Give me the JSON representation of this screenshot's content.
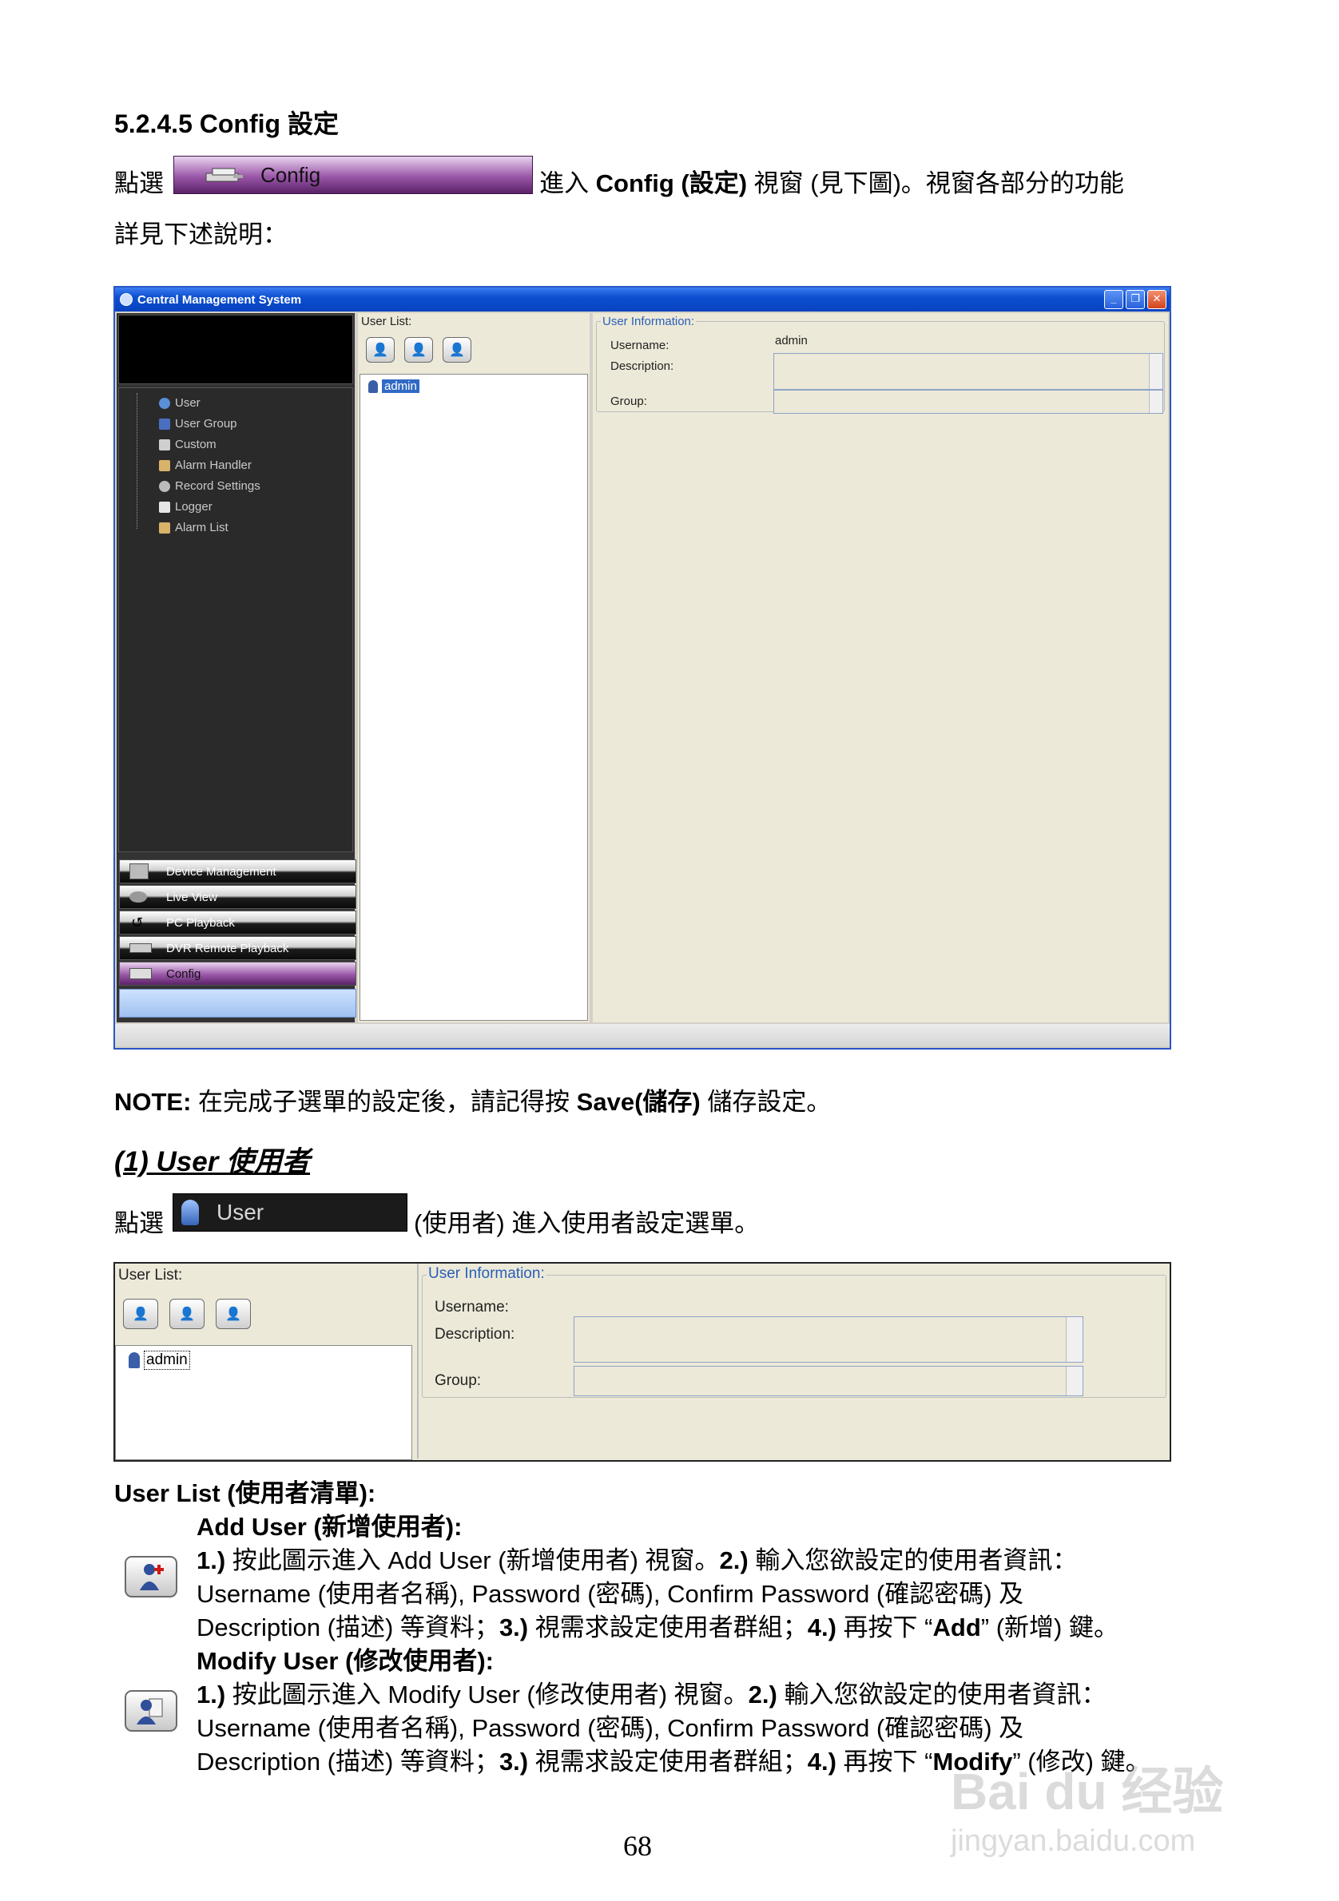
{
  "section_heading": "5.2.4.5 Config 設定",
  "intro": {
    "click_prefix": "點選",
    "button_label": "Config",
    "text_a": "進入 ",
    "text_b": "Config (設定)",
    "text_c": " 視窗 (見下圖)。視窗各部分的功能",
    "line2": "詳見下述說明："
  },
  "screenshot": {
    "title": "Central Management System",
    "tree_items": [
      "User",
      "User Group",
      "Custom",
      "Alarm Handler",
      "Record Settings",
      "Logger",
      "Alarm List"
    ],
    "nav_buttons": [
      "Device Management",
      "Live View",
      "PC Playback",
      "DVR Remote Playback",
      "Config"
    ],
    "user_list_label": "User List:",
    "list_item": "admin",
    "info_label": "User Information:",
    "username_label": "Username:",
    "username_value": "admin",
    "description_label": "Description:",
    "group_label": "Group:"
  },
  "note": {
    "label": "NOTE:",
    "text_a": " 在完成子選單的設定後，請記得按 ",
    "save": "Save(儲存)",
    "text_b": " 儲存設定。"
  },
  "user_heading": "(1) User 使用者",
  "user_intro": {
    "click_prefix": "點選",
    "button_label": "User",
    "text": "(使用者) 進入使用者設定選單。"
  },
  "user_panel": {
    "user_list_label": "User List:",
    "list_item": "admin",
    "info_label": "User Information:",
    "username_label": "Username:",
    "description_label": "Description:",
    "group_label": "Group:"
  },
  "user_list_heading": "User List (使用者清單):",
  "add_user": {
    "heading": "Add User (新增使用者):",
    "n1": "1.)",
    "l1a": " 按此圖示進入 Add User (新增使用者) 視窗。",
    "n2": "2.)",
    "l1b": " 輸入您欲設定的使用者資訊：",
    "l2": "Username (使用者名稱), Password (密碼), Confirm Password (確認密碼) 及",
    "l3a": "Description (描述) 等資料；",
    "n3": "3.)",
    "l3b": " 視需求設定使用者群組；",
    "n4": "4.)",
    "l3c": " 再按下 “",
    "key": "Add",
    "l3d": "” (新增) 鍵。"
  },
  "modify_user": {
    "heading": "Modify User (修改使用者):",
    "n1": "1.)",
    "l1a": " 按此圖示進入 Modify User (修改使用者) 視窗。",
    "n2": "2.)",
    "l1b": " 輸入您欲設定的使用者資訊：",
    "l2": "Username (使用者名稱), Password (密碼), Confirm Password (確認密碼) 及",
    "l3a": "Description (描述) 等資料；",
    "n3": "3.)",
    "l3b": " 視需求設定使用者群組；",
    "n4": "4.)",
    "l3c": " 再按下 “",
    "key": "Modify",
    "l3d": "” (修改) 鍵。"
  },
  "page_number": "68",
  "watermark": {
    "line1": "Bai du 经验",
    "line2": "jingyan.baidu.com"
  },
  "colors": {
    "config_purple": "#8a3f9b",
    "titlebar_blue": "#0d4fd0",
    "dark_pane": "#333333",
    "selection": "#316ac5"
  }
}
